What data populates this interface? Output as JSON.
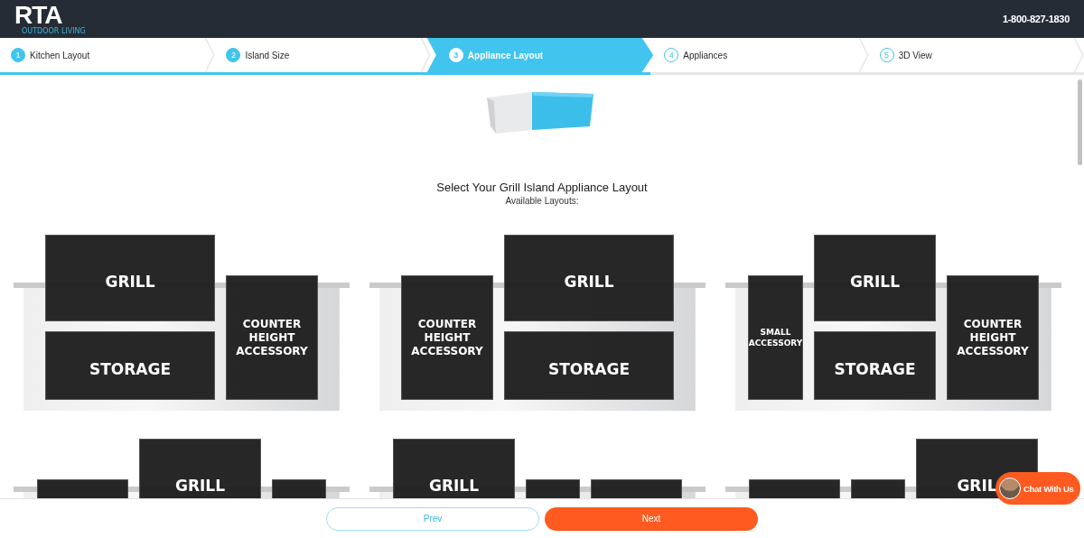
{
  "header": {
    "logo": "RTA",
    "logo_tagline": "OUTDOOR LIVING",
    "phone": "1-800-827-1830"
  },
  "steps": [
    {
      "number": "1",
      "label": "Kitchen Layout",
      "completed": true,
      "selected": false
    },
    {
      "number": "2",
      "label": "Island Size",
      "completed": true,
      "selected": false
    },
    {
      "number": "3",
      "label": "Appliance Layout",
      "completed": false,
      "selected": true
    },
    {
      "number": "4",
      "label": "Appliances",
      "completed": false,
      "selected": false
    },
    {
      "number": "5",
      "label": "3D View",
      "completed": false,
      "selected": false
    }
  ],
  "title": "Select Your Grill Island Appliance Layout",
  "subtitle": "Available Layouts:",
  "layouts": [
    {
      "columns": [
        {
          "kind": "stack-wide",
          "top": "GRILL",
          "bottom": "STORAGE"
        },
        {
          "kind": "counter",
          "label": "COUNTER HEIGHT ACCESSORY"
        }
      ]
    },
    {
      "columns": [
        {
          "kind": "counter",
          "label": "COUNTER HEIGHT ACCESSORY"
        },
        {
          "kind": "stack-wide",
          "top": "GRILL",
          "bottom": "STORAGE"
        }
      ]
    },
    {
      "columns": [
        {
          "kind": "small",
          "label": "SMALL ACCESSORY"
        },
        {
          "kind": "stack",
          "top": "GRILL",
          "bottom": "STORAGE"
        },
        {
          "kind": "counter",
          "label": "COUNTER HEIGHT ACCESSORY"
        }
      ]
    },
    {
      "columns": [
        {
          "kind": "counter-wide"
        },
        {
          "kind": "stack",
          "top": "GRILL"
        },
        {
          "kind": "counter-narrow"
        }
      ]
    },
    {
      "columns": [
        {
          "kind": "stack",
          "top": "GRILL"
        },
        {
          "kind": "counter-narrow"
        },
        {
          "kind": "counter-wide"
        }
      ]
    },
    {
      "columns": [
        {
          "kind": "counter-wide"
        },
        {
          "kind": "counter-narrow"
        },
        {
          "kind": "stack",
          "top": "GRIL"
        }
      ]
    }
  ],
  "buttons": {
    "prev": "Prev",
    "next": "Next"
  },
  "chat": {
    "label": "Chat With Us"
  }
}
